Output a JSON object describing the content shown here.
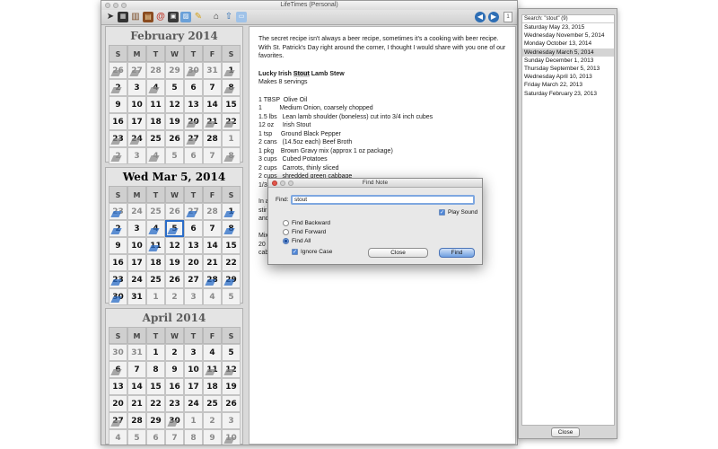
{
  "window": {
    "title": "LifeTimes (Personal)"
  },
  "toolbar": {
    "icons": [
      "cursor-icon",
      "film-icon",
      "book-icon",
      "notebook-icon",
      "at-sign-icon",
      "calendar-icon",
      "photo-icon",
      "pencil-icon",
      "house-icon",
      "upload-icon",
      "window-icon"
    ],
    "nav": {
      "back": "◀",
      "forward": "▶"
    }
  },
  "calendars": [
    {
      "title": "February 2014",
      "current": false,
      "dows": [
        "S",
        "M",
        "T",
        "W",
        "T",
        "F",
        "S"
      ],
      "days": [
        {
          "d": "26",
          "out": true,
          "n": true
        },
        {
          "d": "27",
          "out": true,
          "n": true
        },
        {
          "d": "28",
          "out": true
        },
        {
          "d": "29",
          "out": true
        },
        {
          "d": "30",
          "out": true,
          "n": true
        },
        {
          "d": "31",
          "out": true
        },
        {
          "d": "1",
          "n": true
        },
        {
          "d": "2",
          "n": true
        },
        {
          "d": "3"
        },
        {
          "d": "4",
          "n": true
        },
        {
          "d": "5"
        },
        {
          "d": "6"
        },
        {
          "d": "7"
        },
        {
          "d": "8",
          "n": true
        },
        {
          "d": "9"
        },
        {
          "d": "10"
        },
        {
          "d": "11"
        },
        {
          "d": "12"
        },
        {
          "d": "13"
        },
        {
          "d": "14"
        },
        {
          "d": "15"
        },
        {
          "d": "16"
        },
        {
          "d": "17"
        },
        {
          "d": "18"
        },
        {
          "d": "19"
        },
        {
          "d": "20",
          "n": true
        },
        {
          "d": "21",
          "n": true
        },
        {
          "d": "22",
          "n": true
        },
        {
          "d": "23",
          "n": true
        },
        {
          "d": "24",
          "n": true
        },
        {
          "d": "25"
        },
        {
          "d": "26"
        },
        {
          "d": "27",
          "n": true
        },
        {
          "d": "28"
        },
        {
          "d": "1",
          "out": true
        },
        {
          "d": "2",
          "out": true,
          "n": true
        },
        {
          "d": "3",
          "out": true
        },
        {
          "d": "4",
          "out": true,
          "n": true
        },
        {
          "d": "5",
          "out": true
        },
        {
          "d": "6",
          "out": true
        },
        {
          "d": "7",
          "out": true
        },
        {
          "d": "8",
          "out": true,
          "n": true
        }
      ]
    },
    {
      "title": "Wed Mar 5, 2014",
      "current": true,
      "dows": [
        "S",
        "M",
        "T",
        "W",
        "T",
        "F",
        "S"
      ],
      "days": [
        {
          "d": "23",
          "out": true,
          "n": true
        },
        {
          "d": "24",
          "out": true
        },
        {
          "d": "25",
          "out": true
        },
        {
          "d": "26",
          "out": true
        },
        {
          "d": "27",
          "out": true,
          "n": true
        },
        {
          "d": "28",
          "out": true
        },
        {
          "d": "1",
          "n": true
        },
        {
          "d": "2",
          "n": true
        },
        {
          "d": "3"
        },
        {
          "d": "4",
          "n": true
        },
        {
          "d": "5",
          "n": true,
          "today": true
        },
        {
          "d": "6"
        },
        {
          "d": "7"
        },
        {
          "d": "8",
          "n": true
        },
        {
          "d": "9"
        },
        {
          "d": "10"
        },
        {
          "d": "11",
          "n": true
        },
        {
          "d": "12"
        },
        {
          "d": "13"
        },
        {
          "d": "14"
        },
        {
          "d": "15"
        },
        {
          "d": "16"
        },
        {
          "d": "17"
        },
        {
          "d": "18"
        },
        {
          "d": "19"
        },
        {
          "d": "20"
        },
        {
          "d": "21"
        },
        {
          "d": "22"
        },
        {
          "d": "23",
          "n": true
        },
        {
          "d": "24"
        },
        {
          "d": "25"
        },
        {
          "d": "26"
        },
        {
          "d": "27"
        },
        {
          "d": "28",
          "n": true
        },
        {
          "d": "29",
          "n": true
        },
        {
          "d": "30",
          "n": true
        },
        {
          "d": "31"
        },
        {
          "d": "1",
          "out": true
        },
        {
          "d": "2",
          "out": true
        },
        {
          "d": "3",
          "out": true
        },
        {
          "d": "4",
          "out": true
        },
        {
          "d": "5",
          "out": true
        }
      ]
    },
    {
      "title": "April 2014",
      "current": false,
      "dows": [
        "S",
        "M",
        "T",
        "W",
        "T",
        "F",
        "S"
      ],
      "days": [
        {
          "d": "30",
          "out": true
        },
        {
          "d": "31",
          "out": true
        },
        {
          "d": "1"
        },
        {
          "d": "2"
        },
        {
          "d": "3"
        },
        {
          "d": "4"
        },
        {
          "d": "5"
        },
        {
          "d": "6",
          "n": true
        },
        {
          "d": "7"
        },
        {
          "d": "8"
        },
        {
          "d": "9"
        },
        {
          "d": "10"
        },
        {
          "d": "11",
          "n": true
        },
        {
          "d": "12",
          "n": true
        },
        {
          "d": "13"
        },
        {
          "d": "14"
        },
        {
          "d": "15"
        },
        {
          "d": "16"
        },
        {
          "d": "17"
        },
        {
          "d": "18"
        },
        {
          "d": "19"
        },
        {
          "d": "20"
        },
        {
          "d": "21"
        },
        {
          "d": "22"
        },
        {
          "d": "23"
        },
        {
          "d": "24"
        },
        {
          "d": "25"
        },
        {
          "d": "26"
        },
        {
          "d": "27",
          "n": true
        },
        {
          "d": "28"
        },
        {
          "d": "29"
        },
        {
          "d": "30",
          "n": true
        },
        {
          "d": "1",
          "out": true
        },
        {
          "d": "2",
          "out": true
        },
        {
          "d": "3",
          "out": true
        },
        {
          "d": "4",
          "out": true
        },
        {
          "d": "5",
          "out": true
        },
        {
          "d": "6",
          "out": true
        },
        {
          "d": "7",
          "out": true
        },
        {
          "d": "8",
          "out": true
        },
        {
          "d": "9",
          "out": true
        },
        {
          "d": "10",
          "out": true,
          "n": true
        }
      ]
    }
  ],
  "note": {
    "intro": "The secret recipe isn't always a beer recipe, sometimes it's a cooking with beer recipe. With St. Patrick's Day right around the corner, I thought I would share with you one of our favorites.",
    "title_pre": "Lucky Irish ",
    "title_hl": "Stout",
    "title_post": " Lamb Stew",
    "servings": "Makes 8 servings",
    "ingredients": [
      "1 TBSP  Olive Oil",
      "1          Medium Onion, coarsely chopped",
      "1.5 lbs   Lean lamb shoulder (boneless) cut into 3/4 inch cubes",
      "12 oz     Irish Stout",
      "1 tsp     Ground Black Pepper",
      "2 cans   (14.5oz each) Beef Broth",
      "1 pkg    Brown Gravy mix (approx 1 oz package)",
      "3 cups   Cubed Potatoes",
      "2 cups   Carrots, thinly sliced",
      "2 cups   shredded green cabbage",
      "1/3 cup  chopped parsley (for garnish)."
    ],
    "partial": [
      "In a",
      "stir",
      "and",
      "",
      "Mix",
      "20 m",
      "cab"
    ]
  },
  "results": {
    "header": "Search: \"stout\" (9)",
    "items": [
      "Saturday May 23, 2015",
      "Wednesday November 5, 2014",
      "Monday October 13, 2014",
      "Wednesday March 5, 2014",
      "Sunday December 1, 2013",
      "Thursday September 5, 2013",
      "Wednesday April 10, 2013",
      "Friday March 22, 2013",
      "Saturday February 23, 2013"
    ],
    "selected_index": 3,
    "close_label": "Close"
  },
  "find": {
    "title": "Find Note",
    "label": "Find:",
    "value": "stout",
    "play_sound": "Play Sound",
    "find_backward": "Find Backward",
    "find_forward": "Find Forward",
    "find_all": "Find All",
    "ignore_case": "Ignore Case",
    "close_label": "Close",
    "find_label": "Find"
  },
  "colors": {
    "accent": "#2a6cc7",
    "selection": "#d4d4d4"
  }
}
